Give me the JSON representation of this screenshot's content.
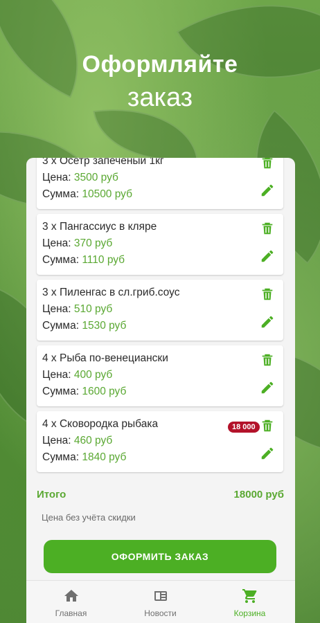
{
  "header": {
    "title": "Оформляйте",
    "subtitle": "заказ"
  },
  "cart": {
    "items": [
      {
        "name": "3 х Осетр запеченый 1кг",
        "price_label": "Цена: ",
        "price": "3500 руб",
        "sum_label": "Сумма: ",
        "sum": "10500 руб"
      },
      {
        "name": "3 х Пангассиус в кляре",
        "price_label": "Цена: ",
        "price": "370 руб",
        "sum_label": "Сумма: ",
        "sum": "1110 руб"
      },
      {
        "name": "3 х Пиленгас в сл.гриб.соус",
        "price_label": "Цена: ",
        "price": "510 руб",
        "sum_label": "Сумма: ",
        "sum": "1530 руб"
      },
      {
        "name": "4 х Рыба по-венециански",
        "price_label": "Цена: ",
        "price": "400 руб",
        "sum_label": "Сумма: ",
        "sum": "1600 руб"
      },
      {
        "name": "4 х Сковородка рыбака",
        "price_label": "Цена: ",
        "price": "460 руб",
        "sum_label": "Сумма: ",
        "sum": "1840 руб"
      }
    ],
    "total_label": "Итого",
    "total_value": "18000 руб",
    "note": "Цена без учёта скидки",
    "order_button": "ОФОРМИТЬ ЗАКАЗ"
  },
  "nav": {
    "items": [
      {
        "label": "Главная",
        "icon": "home-icon"
      },
      {
        "label": "Новости",
        "icon": "news-icon"
      },
      {
        "label": "Корзина",
        "icon": "cart-icon"
      }
    ],
    "cart_badge": "18 000"
  },
  "colors": {
    "accent": "#4caf24",
    "accent_text": "#5aa832",
    "badge": "#b3122a"
  }
}
